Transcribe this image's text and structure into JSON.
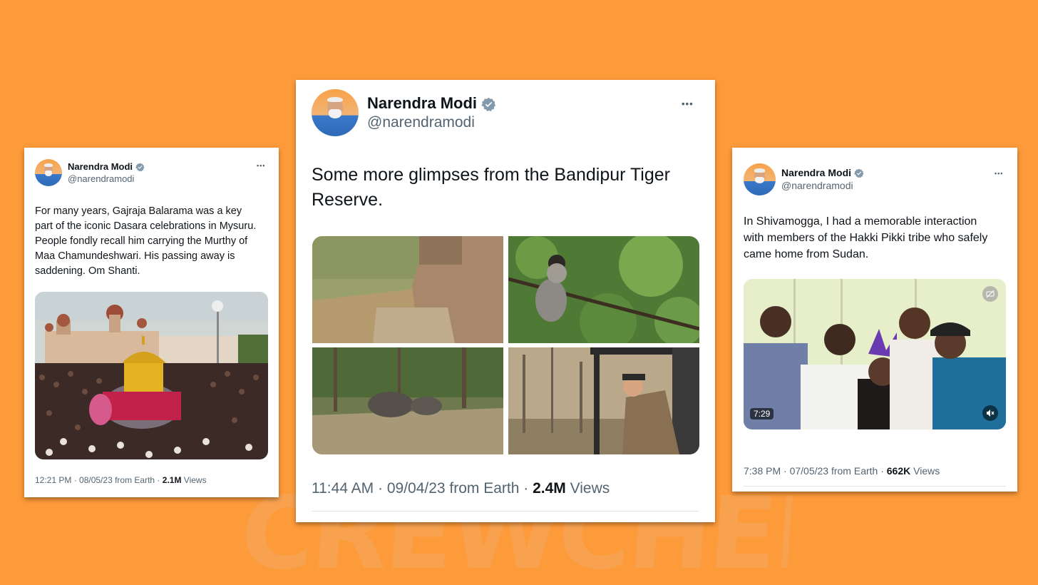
{
  "watermark": "CREWCHEK",
  "tweets": [
    {
      "name": "Narendra Modi",
      "handle": "@narendramodi",
      "text": "For many years, Gajraja Balarama was a key part of the iconic Dasara celebrations in Mysuru. People fondly recall him carrying the Murthy of Maa Chamundeshwari. His passing away is saddening. Om Shanti.",
      "meta_prefix": "12:21 PM · 08/05/23 from Earth · ",
      "views_count": "2.1M",
      "views_label": " Views"
    },
    {
      "name": "Narendra Modi",
      "handle": "@narendramodi",
      "text": "Some more glimpses from the Bandipur Tiger Reserve.",
      "meta_prefix": "11:44 AM · 09/04/23 from Earth · ",
      "views_count": "2.4M",
      "views_label": " Views"
    },
    {
      "name": "Narendra Modi",
      "handle": "@narendramodi",
      "text": "In Shivamogga, I had a memorable interaction with members of the Hakki Pikki tribe who safely came home from Sudan.",
      "meta_prefix": "7:38 PM · 07/05/23 from Earth · ",
      "views_count": "662K",
      "views_label": " Views",
      "video_duration": "7:29"
    }
  ],
  "more_glyph": "•••",
  "colors": {
    "background": "#fd9a3a",
    "verified": "#829aab",
    "text": "#0f1419",
    "secondary": "#536471"
  }
}
